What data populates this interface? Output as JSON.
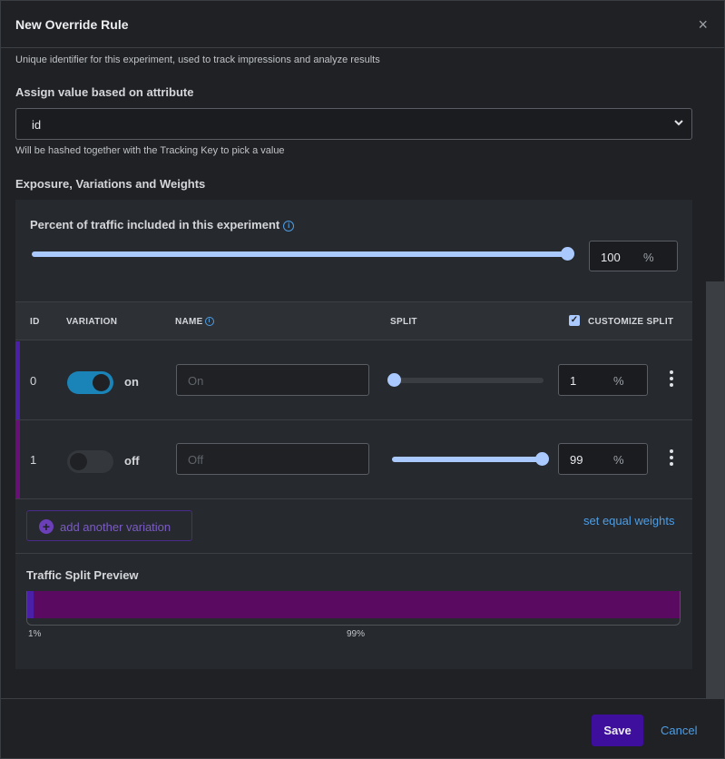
{
  "modal": {
    "title": "New Override Rule",
    "close_symbol": "×"
  },
  "tracking_key_help": "Unique identifier for this experiment, used to track impressions and analyze results",
  "assign": {
    "label": "Assign value based on attribute",
    "value": "id",
    "help": "Will be hashed together with the Tracking Key to pick a value"
  },
  "exposure": {
    "section_label": "Exposure, Variations and Weights",
    "traffic_label": "Percent of traffic included in this experiment",
    "traffic_percent": 100,
    "traffic_value": "100",
    "percent_sign": "%"
  },
  "table": {
    "headers": {
      "id": "ID",
      "variation": "VARIATION",
      "name": "NAME",
      "split": "SPLIT",
      "customize": "CUSTOMIZE SPLIT"
    },
    "customize_checked": true,
    "rows": [
      {
        "id": "0",
        "toggle_on": true,
        "toggle_label": "on",
        "name_placeholder": "On",
        "split_value": "1",
        "split_percent": 1,
        "color": "#4b20a8"
      },
      {
        "id": "1",
        "toggle_on": false,
        "toggle_label": "off",
        "name_placeholder": "Off",
        "split_value": "99",
        "split_percent": 99,
        "color": "#6b0f78"
      }
    ]
  },
  "actions": {
    "add_variation": "add another variation",
    "equal_weights": "set equal weights"
  },
  "preview": {
    "label": "Traffic Split Preview",
    "labels": [
      "1%",
      "99%"
    ]
  },
  "footer": {
    "save": "Save",
    "cancel": "Cancel"
  },
  "colors": {
    "accent_blue": "#4d9ee6",
    "slider": "#a9c9ff",
    "toggle_on": "#1a83b8",
    "save_button": "#3e0e9c",
    "variation_0": "#4b20a8",
    "variation_1": "#5a0a60"
  }
}
